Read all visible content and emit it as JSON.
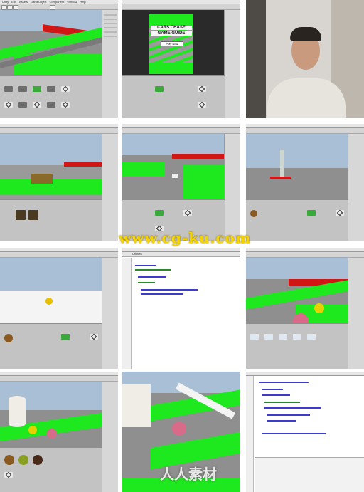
{
  "menu": [
    "Unity",
    "Edit",
    "Assets",
    "GameObject",
    "Component",
    "Window",
    "Help"
  ],
  "game_title": {
    "line1": "CARS CHASE",
    "line2": "GAME GUIDE",
    "button": "Play Now"
  },
  "code_panel": {
    "tab": "Untitled"
  },
  "watermarks": {
    "cgku": "www.cg-ku.com",
    "renren": "人人素材"
  },
  "colors": {
    "grass": "#1ee81e",
    "wall": "#d11616",
    "editor_bg": "#c9c9c9",
    "watermark_yellow": "#f3d400"
  }
}
